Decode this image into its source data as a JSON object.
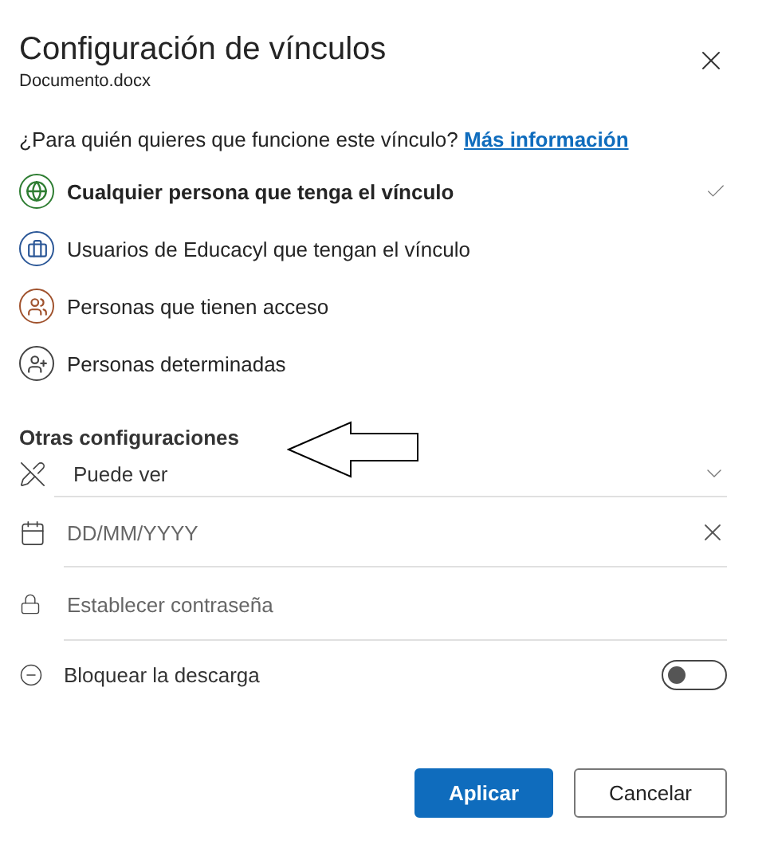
{
  "dialog": {
    "title": "Configuración de vínculos",
    "subtitle": "Documento.docx"
  },
  "question": {
    "text": "¿Para quién quieres que funcione este vínculo?",
    "link": "Más información"
  },
  "options": [
    {
      "label": "Cualquier persona que tenga el vínculo",
      "kind": "globe",
      "color": "#2e7d32",
      "selected": true
    },
    {
      "label": "Usuarios de Educacyl que tengan el vínculo",
      "kind": "briefcase",
      "color": "#2b5797",
      "selected": false
    },
    {
      "label": "Personas que tienen acceso",
      "kind": "people",
      "color": "#a0522d",
      "selected": false
    },
    {
      "label": "Personas determinadas",
      "kind": "people-add",
      "color": "#444444",
      "selected": false
    }
  ],
  "other_settings": {
    "heading": "Otras configuraciones",
    "rows": [
      {
        "kind": "dropdown",
        "value": "Puede ver"
      },
      {
        "kind": "date",
        "placeholder": "DD/MM/YYYY"
      },
      {
        "kind": "password",
        "placeholder": "Establecer contraseña"
      },
      {
        "kind": "toggle",
        "label": "Bloquear la descarga",
        "on": false
      }
    ]
  },
  "buttons": [
    {
      "label": "Aplicar",
      "kind": "primary"
    },
    {
      "label": "Cancelar",
      "kind": "secondary"
    }
  ]
}
